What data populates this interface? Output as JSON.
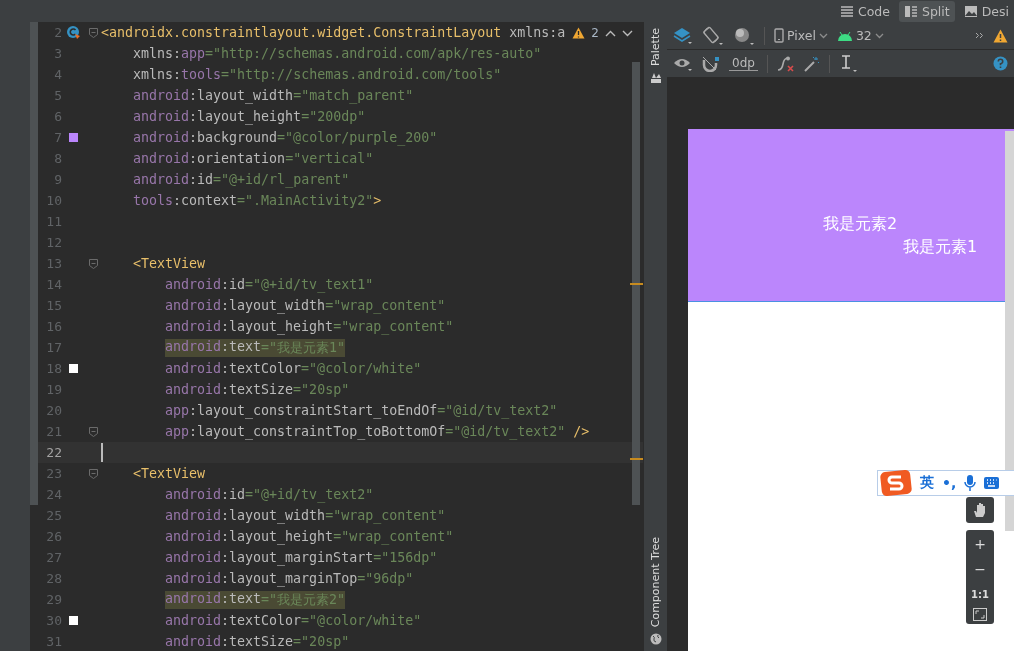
{
  "view_modes": [
    {
      "label": "Code",
      "selected": false
    },
    {
      "label": "Split",
      "selected": true
    },
    {
      "label": "Desi",
      "selected": false
    }
  ],
  "editor": {
    "warning_count": "2",
    "lines": [
      {
        "number": "2",
        "kind": "root",
        "fold": true,
        "highlighted": false,
        "current": false,
        "marker": {
          "kind": "class"
        },
        "tokens": [
          {
            "kind": "tag",
            "text": "<androidx.constraintlayout.widget.ConstraintLayout"
          },
          {
            "kind": "plain",
            "text": " xmlns:a"
          }
        ]
      },
      {
        "number": "3",
        "kind": "root_attr",
        "fold": false,
        "highlighted": false,
        "current": false,
        "tokens": [
          {
            "kind": "plain",
            "text": "xmlns:"
          },
          {
            "kind": "ns",
            "text": "app"
          },
          {
            "kind": "value",
            "text": "=\"http://schemas.android.com/apk/res-auto\""
          }
        ]
      },
      {
        "number": "4",
        "kind": "root_attr",
        "fold": false,
        "highlighted": false,
        "current": false,
        "tokens": [
          {
            "kind": "plain",
            "text": "xmlns:"
          },
          {
            "kind": "ns",
            "text": "tools"
          },
          {
            "kind": "value",
            "text": "=\"http://schemas.android.com/tools\""
          }
        ]
      },
      {
        "number": "5",
        "kind": "root_attr",
        "fold": false,
        "highlighted": false,
        "current": false,
        "tokens": [
          {
            "kind": "ns",
            "text": "android"
          },
          {
            "kind": "plain",
            "text": ":layout_width"
          },
          {
            "kind": "value",
            "text": "=\"match_parent\""
          }
        ]
      },
      {
        "number": "6",
        "kind": "root_attr",
        "fold": false,
        "highlighted": false,
        "current": false,
        "tokens": [
          {
            "kind": "ns",
            "text": "android"
          },
          {
            "kind": "plain",
            "text": ":layout_height"
          },
          {
            "kind": "value",
            "text": "=\"200dp\""
          }
        ]
      },
      {
        "number": "7",
        "kind": "root_attr",
        "fold": false,
        "highlighted": false,
        "current": false,
        "marker": {
          "kind": "swatch",
          "color": "#bb86fc"
        },
        "tokens": [
          {
            "kind": "ns",
            "text": "android"
          },
          {
            "kind": "plain",
            "text": ":background"
          },
          {
            "kind": "value",
            "text": "=\"@color/purple_200\""
          }
        ]
      },
      {
        "number": "8",
        "kind": "root_attr",
        "fold": false,
        "highlighted": false,
        "current": false,
        "tokens": [
          {
            "kind": "ns",
            "text": "android"
          },
          {
            "kind": "plain",
            "text": ":orientation"
          },
          {
            "kind": "value",
            "text": "=\"vertical\""
          }
        ]
      },
      {
        "number": "9",
        "kind": "root_attr",
        "fold": false,
        "highlighted": false,
        "current": false,
        "tokens": [
          {
            "kind": "ns",
            "text": "android"
          },
          {
            "kind": "plain",
            "text": ":id"
          },
          {
            "kind": "value",
            "text": "=\"@+id/rl_parent\""
          }
        ]
      },
      {
        "number": "10",
        "kind": "root_attr",
        "fold": false,
        "highlighted": false,
        "current": false,
        "tokens": [
          {
            "kind": "ns",
            "text": "tools"
          },
          {
            "kind": "plain",
            "text": ":context"
          },
          {
            "kind": "value",
            "text": "=\".MainActivity2\""
          },
          {
            "kind": "tag",
            "text": ">"
          }
        ]
      },
      {
        "number": "11",
        "kind": "blank",
        "fold": false,
        "highlighted": false,
        "current": false
      },
      {
        "number": "12",
        "kind": "blank",
        "fold": false,
        "highlighted": false,
        "current": false
      },
      {
        "number": "13",
        "kind": "element",
        "fold": true,
        "highlighted": false,
        "current": false,
        "tokens": [
          {
            "kind": "tag",
            "text": "<TextView"
          }
        ]
      },
      {
        "number": "14",
        "kind": "element_attr",
        "fold": false,
        "highlighted": false,
        "current": false,
        "tokens": [
          {
            "kind": "ns",
            "text": "android"
          },
          {
            "kind": "plain",
            "text": ":id"
          },
          {
            "kind": "value",
            "text": "=\"@+id/tv_text1\""
          }
        ]
      },
      {
        "number": "15",
        "kind": "element_attr",
        "fold": false,
        "highlighted": false,
        "current": false,
        "tokens": [
          {
            "kind": "ns",
            "text": "android"
          },
          {
            "kind": "plain",
            "text": ":layout_width"
          },
          {
            "kind": "value",
            "text": "=\"wrap_content\""
          }
        ]
      },
      {
        "number": "16",
        "kind": "element_attr",
        "fold": false,
        "highlighted": false,
        "current": false,
        "tokens": [
          {
            "kind": "ns",
            "text": "android"
          },
          {
            "kind": "plain",
            "text": ":layout_height"
          },
          {
            "kind": "value",
            "text": "=\"wrap_content\""
          }
        ]
      },
      {
        "number": "17",
        "kind": "element_attr",
        "fold": false,
        "highlighted": true,
        "current": false,
        "tokens": [
          {
            "kind": "ns",
            "text": "android"
          },
          {
            "kind": "plain",
            "text": ":text"
          },
          {
            "kind": "value",
            "text": "=\"我是元素1\""
          }
        ]
      },
      {
        "number": "18",
        "kind": "element_attr",
        "fold": false,
        "highlighted": false,
        "current": false,
        "marker": {
          "kind": "swatch",
          "color": "#ffffff"
        },
        "tokens": [
          {
            "kind": "ns",
            "text": "android"
          },
          {
            "kind": "plain",
            "text": ":textColor"
          },
          {
            "kind": "value",
            "text": "=\"@color/white\""
          }
        ]
      },
      {
        "number": "19",
        "kind": "element_attr",
        "fold": false,
        "highlighted": false,
        "current": false,
        "tokens": [
          {
            "kind": "ns",
            "text": "android"
          },
          {
            "kind": "plain",
            "text": ":textSize"
          },
          {
            "kind": "value",
            "text": "=\"20sp\""
          }
        ]
      },
      {
        "number": "20",
        "kind": "element_attr",
        "fold": false,
        "highlighted": false,
        "current": false,
        "tokens": [
          {
            "kind": "ns",
            "text": "app"
          },
          {
            "kind": "plain",
            "text": ":layout_constraintStart_toEndOf"
          },
          {
            "kind": "value",
            "text": "=\"@id/tv_text2\""
          }
        ]
      },
      {
        "number": "21",
        "kind": "element_attr",
        "fold": true,
        "highlighted": false,
        "current": false,
        "tokens": [
          {
            "kind": "ns",
            "text": "app"
          },
          {
            "kind": "plain",
            "text": ":layout_constraintTop_toBottomOf"
          },
          {
            "kind": "value",
            "text": "=\"@id/tv_text2\""
          },
          {
            "kind": "tag",
            "text": " />"
          }
        ]
      },
      {
        "number": "22",
        "kind": "blank",
        "fold": false,
        "highlighted": false,
        "current": true
      },
      {
        "number": "23",
        "kind": "element",
        "fold": true,
        "highlighted": false,
        "current": false,
        "tokens": [
          {
            "kind": "tag",
            "text": "<TextView"
          }
        ]
      },
      {
        "number": "24",
        "kind": "element_attr",
        "fold": false,
        "highlighted": false,
        "current": false,
        "tokens": [
          {
            "kind": "ns",
            "text": "android"
          },
          {
            "kind": "plain",
            "text": ":id"
          },
          {
            "kind": "value",
            "text": "=\"@+id/tv_text2\""
          }
        ]
      },
      {
        "number": "25",
        "kind": "element_attr",
        "fold": false,
        "highlighted": false,
        "current": false,
        "tokens": [
          {
            "kind": "ns",
            "text": "android"
          },
          {
            "kind": "plain",
            "text": ":layout_width"
          },
          {
            "kind": "value",
            "text": "=\"wrap_content\""
          }
        ]
      },
      {
        "number": "26",
        "kind": "element_attr",
        "fold": false,
        "highlighted": false,
        "current": false,
        "tokens": [
          {
            "kind": "ns",
            "text": "android"
          },
          {
            "kind": "plain",
            "text": ":layout_height"
          },
          {
            "kind": "value",
            "text": "=\"wrap_content\""
          }
        ]
      },
      {
        "number": "27",
        "kind": "element_attr",
        "fold": false,
        "highlighted": false,
        "current": false,
        "tokens": [
          {
            "kind": "ns",
            "text": "android"
          },
          {
            "kind": "plain",
            "text": ":layout_marginStart"
          },
          {
            "kind": "value",
            "text": "=\"156dp\""
          }
        ]
      },
      {
        "number": "28",
        "kind": "element_attr",
        "fold": false,
        "highlighted": false,
        "current": false,
        "tokens": [
          {
            "kind": "ns",
            "text": "android"
          },
          {
            "kind": "plain",
            "text": ":layout_marginTop"
          },
          {
            "kind": "value",
            "text": "=\"96dp\""
          }
        ]
      },
      {
        "number": "29",
        "kind": "element_attr",
        "fold": false,
        "highlighted": true,
        "current": false,
        "tokens": [
          {
            "kind": "ns",
            "text": "android"
          },
          {
            "kind": "plain",
            "text": ":text"
          },
          {
            "kind": "value",
            "text": "=\"我是元素2\""
          }
        ]
      },
      {
        "number": "30",
        "kind": "element_attr",
        "fold": false,
        "highlighted": false,
        "current": false,
        "marker": {
          "kind": "swatch",
          "color": "#ffffff"
        },
        "tokens": [
          {
            "kind": "ns",
            "text": "android"
          },
          {
            "kind": "plain",
            "text": ":textColor"
          },
          {
            "kind": "value",
            "text": "=\"@color/white\""
          }
        ]
      },
      {
        "number": "31",
        "kind": "element_attr",
        "fold": false,
        "highlighted": false,
        "current": false,
        "tokens": [
          {
            "kind": "ns",
            "text": "android"
          },
          {
            "kind": "plain",
            "text": ":textSize"
          },
          {
            "kind": "value",
            "text": "=\"20sp\""
          }
        ]
      }
    ]
  },
  "side_tabs": [
    {
      "label": "Palette"
    },
    {
      "label": "Component Tree"
    }
  ],
  "design_toolbar": {
    "device": "Pixel",
    "api_level": "32",
    "default_margin": "0dp"
  },
  "preview": {
    "texts": [
      "我是元素2",
      "我是元素1"
    ]
  },
  "zoom_controls": [
    "+",
    "−",
    "1:1"
  ],
  "ime_bar": {
    "mode": "英",
    "punctuation": "•,"
  }
}
